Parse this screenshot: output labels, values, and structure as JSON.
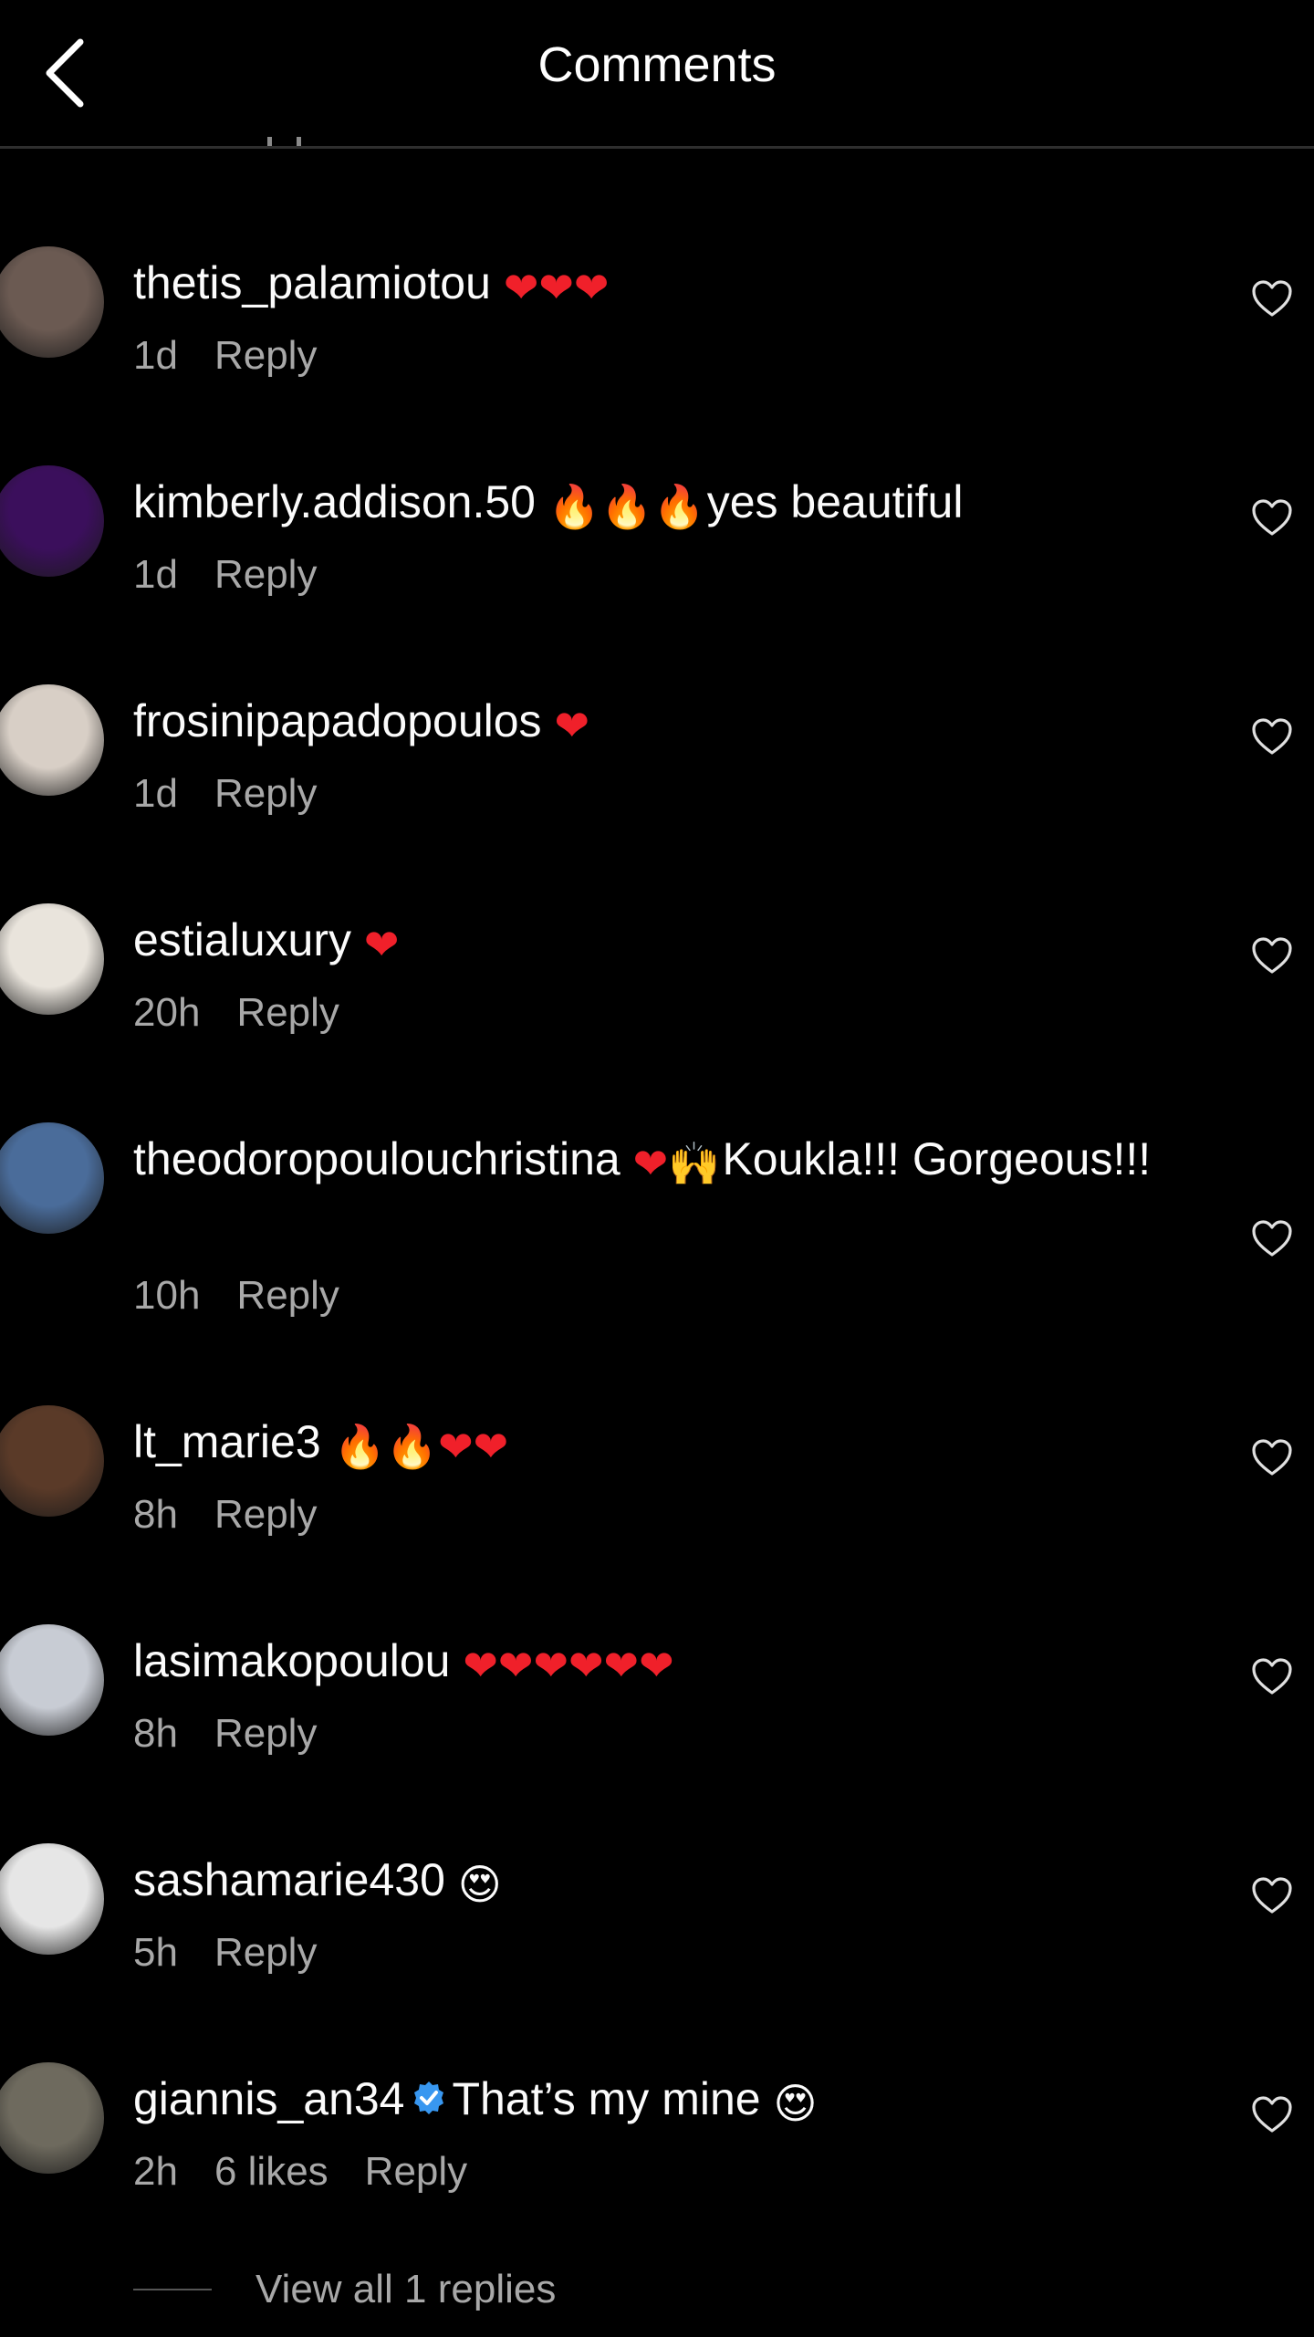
{
  "header": {
    "title": "Comments"
  },
  "comments": [
    {
      "username": "thetis_palamiotou",
      "text": "",
      "emojis": [
        {
          "char": "❤",
          "kind": "heart"
        },
        {
          "char": "❤",
          "kind": "heart"
        },
        {
          "char": "❤",
          "kind": "heart"
        }
      ],
      "time": "1d",
      "reply_label": "Reply",
      "avatar_color": "#6b5a52"
    },
    {
      "username": "kimberly.addison.50",
      "emojis": [
        {
          "char": "🔥",
          "kind": "fire"
        },
        {
          "char": "🔥",
          "kind": "fire"
        },
        {
          "char": "🔥",
          "kind": "fire"
        }
      ],
      "text": "yes beautiful",
      "time": "1d",
      "reply_label": "Reply",
      "avatar_color": "#3b0f5c"
    },
    {
      "username": "frosinipapadopoulos",
      "emojis": [
        {
          "char": "❤",
          "kind": "heart"
        }
      ],
      "text": "",
      "time": "1d",
      "reply_label": "Reply",
      "avatar_color": "#d8cfc6"
    },
    {
      "username": "estialuxury",
      "emojis": [
        {
          "char": "❤",
          "kind": "heart"
        }
      ],
      "text": "",
      "time": "20h",
      "reply_label": "Reply",
      "avatar_color": "#e9e4dc"
    },
    {
      "username": "theodoropoulouchristina",
      "emojis": [
        {
          "char": "❤",
          "kind": "heart"
        },
        {
          "char": "🙌",
          "kind": "hands"
        }
      ],
      "text": "Koukla!!! Gorgeous!!!",
      "time": "10h",
      "reply_label": "Reply",
      "avatar_color": "#4a6c9a"
    },
    {
      "username": "lt_marie3",
      "emojis": [
        {
          "char": "🔥",
          "kind": "fire"
        },
        {
          "char": "🔥",
          "kind": "fire"
        },
        {
          "char": "❤",
          "kind": "heart"
        },
        {
          "char": "❤",
          "kind": "heart"
        }
      ],
      "text": "",
      "time": "8h",
      "reply_label": "Reply",
      "avatar_color": "#5a3a28"
    },
    {
      "username": "lasimakopoulou",
      "emojis": [
        {
          "char": "❤",
          "kind": "heart"
        },
        {
          "char": "❤",
          "kind": "heart"
        },
        {
          "char": "❤",
          "kind": "heart"
        },
        {
          "char": "❤",
          "kind": "heart"
        },
        {
          "char": "❤",
          "kind": "heart"
        },
        {
          "char": "❤",
          "kind": "heart"
        }
      ],
      "text": "",
      "time": "8h",
      "reply_label": "Reply",
      "avatar_color": "#c8ccd4"
    },
    {
      "username": "sashamarie430",
      "emojis": [
        {
          "char": "😍",
          "kind": "smile"
        }
      ],
      "text": "",
      "time": "5h",
      "reply_label": "Reply",
      "avatar_color": "#e6e6e6"
    },
    {
      "username": "giannis_an34",
      "verified": true,
      "text": "That’s my mine",
      "emojis_after": [
        {
          "char": "😍",
          "kind": "smile"
        }
      ],
      "time": "2h",
      "likes": "6 likes",
      "reply_label": "Reply",
      "avatar_color": "#6e6a5e"
    }
  ],
  "view_replies": "View all 1 replies"
}
